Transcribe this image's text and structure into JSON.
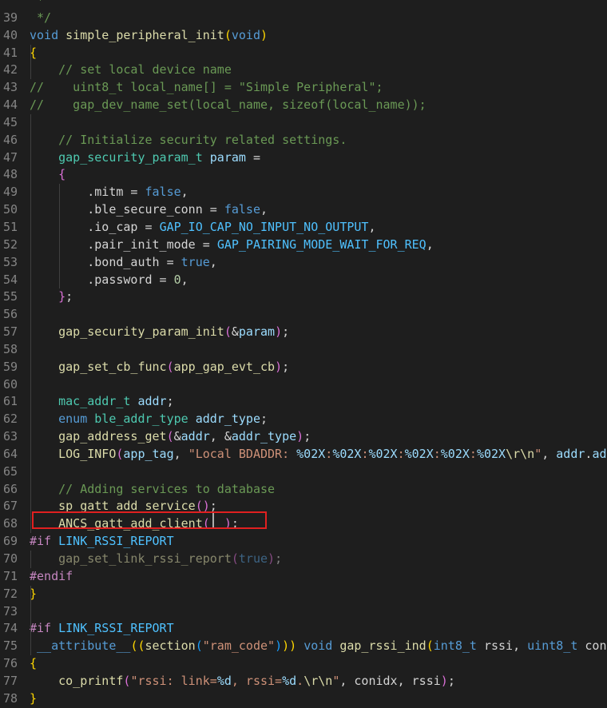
{
  "editor": {
    "theme_colors": {
      "background": "#1e1e1e",
      "keyword": "#569cd6",
      "type": "#4ec9b0",
      "function": "#dcdcaa",
      "comment": "#6a9955",
      "string": "#ce9178",
      "number": "#b5cea8",
      "variable": "#9cdcfe",
      "highlight_box": "#e02020"
    },
    "highlighted_line": "68",
    "lines": [
      {
        "num": "",
        "tokens": [
          [
            "pn",
            " "
          ],
          [
            "cm",
            "*"
          ]
        ]
      },
      {
        "num": "39",
        "tokens": [
          [
            "pn",
            " "
          ],
          [
            "cm",
            "*/"
          ]
        ]
      },
      {
        "num": "40",
        "tokens": [
          [
            "kw",
            "void"
          ],
          [
            "pn",
            " "
          ],
          [
            "fn",
            "simple_peripheral_init"
          ],
          [
            "br1",
            "("
          ],
          [
            "kw",
            "void"
          ],
          [
            "br1",
            ")"
          ]
        ]
      },
      {
        "num": "41",
        "tokens": [
          [
            "br1",
            "{"
          ]
        ]
      },
      {
        "num": "42",
        "tokens": [
          [
            "pn",
            "    "
          ],
          [
            "cm",
            "// set local device name"
          ]
        ]
      },
      {
        "num": "43",
        "tokens": [
          [
            "cm",
            "//    uint8_t local_name[] = \"Simple Peripheral\";"
          ]
        ]
      },
      {
        "num": "44",
        "tokens": [
          [
            "cm",
            "//    gap_dev_name_set(local_name, sizeof(local_name));"
          ]
        ]
      },
      {
        "num": "45",
        "tokens": []
      },
      {
        "num": "46",
        "tokens": [
          [
            "pn",
            "    "
          ],
          [
            "cm",
            "// Initialize security related settings."
          ]
        ]
      },
      {
        "num": "47",
        "tokens": [
          [
            "pn",
            "    "
          ],
          [
            "ty",
            "gap_security_param_t"
          ],
          [
            "pn",
            " "
          ],
          [
            "vr",
            "param"
          ],
          [
            "pn",
            " ="
          ]
        ]
      },
      {
        "num": "48",
        "tokens": [
          [
            "pn",
            "    "
          ],
          [
            "br2",
            "{"
          ]
        ]
      },
      {
        "num": "49",
        "tokens": [
          [
            "pn",
            "        .mitm = "
          ],
          [
            "kw",
            "false"
          ],
          [
            "pn",
            ","
          ]
        ]
      },
      {
        "num": "50",
        "tokens": [
          [
            "pn",
            "        .ble_secure_conn = "
          ],
          [
            "kw",
            "false"
          ],
          [
            "pn",
            ","
          ]
        ]
      },
      {
        "num": "51",
        "tokens": [
          [
            "pn",
            "        .io_cap = "
          ],
          [
            "mc",
            "GAP_IO_CAP_NO_INPUT_NO_OUTPUT"
          ],
          [
            "pn",
            ","
          ]
        ]
      },
      {
        "num": "52",
        "tokens": [
          [
            "pn",
            "        .pair_init_mode = "
          ],
          [
            "mc",
            "GAP_PAIRING_MODE_WAIT_FOR_REQ"
          ],
          [
            "pn",
            ","
          ]
        ]
      },
      {
        "num": "53",
        "tokens": [
          [
            "pn",
            "        .bond_auth = "
          ],
          [
            "kw",
            "true"
          ],
          [
            "pn",
            ","
          ]
        ]
      },
      {
        "num": "54",
        "tokens": [
          [
            "pn",
            "        .password = "
          ],
          [
            "nu",
            "0"
          ],
          [
            "pn",
            ","
          ]
        ]
      },
      {
        "num": "55",
        "tokens": [
          [
            "pn",
            "    "
          ],
          [
            "br2",
            "}"
          ],
          [
            "pn",
            ";"
          ]
        ]
      },
      {
        "num": "56",
        "tokens": []
      },
      {
        "num": "57",
        "tokens": [
          [
            "pn",
            "    "
          ],
          [
            "fn",
            "gap_security_param_init"
          ],
          [
            "br2",
            "("
          ],
          [
            "pn",
            "&"
          ],
          [
            "vr",
            "param"
          ],
          [
            "br2",
            ")"
          ],
          [
            "pn",
            ";"
          ]
        ]
      },
      {
        "num": "58",
        "tokens": []
      },
      {
        "num": "59",
        "tokens": [
          [
            "pn",
            "    "
          ],
          [
            "fn",
            "gap_set_cb_func"
          ],
          [
            "br2",
            "("
          ],
          [
            "fn",
            "app_gap_evt_cb"
          ],
          [
            "br2",
            ")"
          ],
          [
            "pn",
            ";"
          ]
        ]
      },
      {
        "num": "60",
        "tokens": []
      },
      {
        "num": "61",
        "tokens": [
          [
            "pn",
            "    "
          ],
          [
            "ty",
            "mac_addr_t"
          ],
          [
            "pn",
            " "
          ],
          [
            "vr",
            "addr"
          ],
          [
            "pn",
            ";"
          ]
        ]
      },
      {
        "num": "62",
        "tokens": [
          [
            "pn",
            "    "
          ],
          [
            "kw",
            "enum"
          ],
          [
            "pn",
            " "
          ],
          [
            "ty",
            "ble_addr_type"
          ],
          [
            "pn",
            " "
          ],
          [
            "vr",
            "addr_type"
          ],
          [
            "pn",
            ";"
          ]
        ]
      },
      {
        "num": "63",
        "tokens": [
          [
            "pn",
            "    "
          ],
          [
            "fn",
            "gap_address_get"
          ],
          [
            "br2",
            "("
          ],
          [
            "pn",
            "&"
          ],
          [
            "vr",
            "addr"
          ],
          [
            "pn",
            ", &"
          ],
          [
            "vr",
            "addr_type"
          ],
          [
            "br2",
            ")"
          ],
          [
            "pn",
            ";"
          ]
        ]
      },
      {
        "num": "64",
        "tokens": [
          [
            "pn",
            "    "
          ],
          [
            "fn",
            "LOG_INFO"
          ],
          [
            "br2",
            "("
          ],
          [
            "vr",
            "app_tag"
          ],
          [
            "pn",
            ", "
          ],
          [
            "st",
            "\"Local BDADDR: "
          ],
          [
            "vr",
            "%02X"
          ],
          [
            "st",
            ":"
          ],
          [
            "vr",
            "%02X"
          ],
          [
            "st",
            ":"
          ],
          [
            "vr",
            "%02X"
          ],
          [
            "st",
            ":"
          ],
          [
            "vr",
            "%02X"
          ],
          [
            "st",
            ":"
          ],
          [
            "vr",
            "%02X"
          ],
          [
            "st",
            ":"
          ],
          [
            "vr",
            "%02X"
          ],
          [
            "fn",
            "\\r\\n"
          ],
          [
            "st",
            "\""
          ],
          [
            "pn",
            ", "
          ],
          [
            "vr",
            "addr"
          ],
          [
            "pn",
            "."
          ],
          [
            "vr",
            "addr"
          ]
        ]
      },
      {
        "num": "65",
        "tokens": []
      },
      {
        "num": "66",
        "tokens": [
          [
            "pn",
            "    "
          ],
          [
            "cm",
            "// Adding services to database"
          ]
        ]
      },
      {
        "num": "67",
        "tokens": [
          [
            "pn",
            "    "
          ],
          [
            "fn",
            "sp_gatt_add_service"
          ],
          [
            "br2",
            "()"
          ],
          [
            "pn",
            ";"
          ]
        ]
      },
      {
        "num": "68",
        "tokens": [
          [
            "pn",
            "    "
          ],
          [
            "fn",
            "ANCS_gatt_add_client"
          ],
          [
            "br2",
            "("
          ],
          [
            "pn",
            "  "
          ],
          [
            "br2",
            ")"
          ],
          [
            "pn",
            ";"
          ]
        ]
      },
      {
        "num": "69",
        "tokens": [
          [
            "pr",
            "#if"
          ],
          [
            "pn",
            " "
          ],
          [
            "mc",
            "LINK_RSSI_REPORT"
          ]
        ]
      },
      {
        "num": "70",
        "tokens": [
          [
            "pn",
            "    "
          ],
          [
            "fn dim",
            "gap_set_link_rssi_report"
          ],
          [
            "br2 dim",
            "("
          ],
          [
            "kw dim",
            "true"
          ],
          [
            "br2 dim",
            ")"
          ],
          [
            "pn dim",
            ";"
          ]
        ]
      },
      {
        "num": "71",
        "tokens": [
          [
            "pr",
            "#endif"
          ]
        ]
      },
      {
        "num": "72",
        "tokens": [
          [
            "br1",
            "}"
          ]
        ]
      },
      {
        "num": "73",
        "tokens": []
      },
      {
        "num": "74",
        "tokens": [
          [
            "pr",
            "#if"
          ],
          [
            "pn",
            " "
          ],
          [
            "mc",
            "LINK_RSSI_REPORT"
          ]
        ]
      },
      {
        "num": "75",
        "tokens": [
          [
            "pn",
            " "
          ],
          [
            "kw",
            "__attribute__"
          ],
          [
            "br1",
            "(("
          ],
          [
            "fn",
            "section"
          ],
          [
            "br3",
            "("
          ],
          [
            "st",
            "\"ram_code\""
          ],
          [
            "br3",
            ")"
          ],
          [
            "br1",
            "))"
          ],
          [
            "pn",
            " "
          ],
          [
            "kw",
            "void"
          ],
          [
            "pn",
            " "
          ],
          [
            "fn",
            "gap_rssi_ind"
          ],
          [
            "br1",
            "("
          ],
          [
            "kw",
            "int8_t"
          ],
          [
            "pn",
            " rssi, "
          ],
          [
            "kw",
            "uint8_t"
          ],
          [
            "pn",
            " conid"
          ]
        ]
      },
      {
        "num": "76",
        "tokens": [
          [
            "br1",
            "{"
          ]
        ]
      },
      {
        "num": "77",
        "tokens": [
          [
            "pn",
            "    "
          ],
          [
            "fn",
            "co_printf"
          ],
          [
            "br2",
            "("
          ],
          [
            "st",
            "\"rssi: link="
          ],
          [
            "vr",
            "%d"
          ],
          [
            "st",
            ", rssi="
          ],
          [
            "vr",
            "%d"
          ],
          [
            "st",
            "."
          ],
          [
            "fn",
            "\\r\\n"
          ],
          [
            "st",
            "\""
          ],
          [
            "pn",
            ", conidx, rssi"
          ],
          [
            "br2",
            ")"
          ],
          [
            "pn",
            ";"
          ]
        ]
      },
      {
        "num": "78",
        "tokens": [
          [
            "br1",
            "}"
          ]
        ]
      }
    ]
  }
}
